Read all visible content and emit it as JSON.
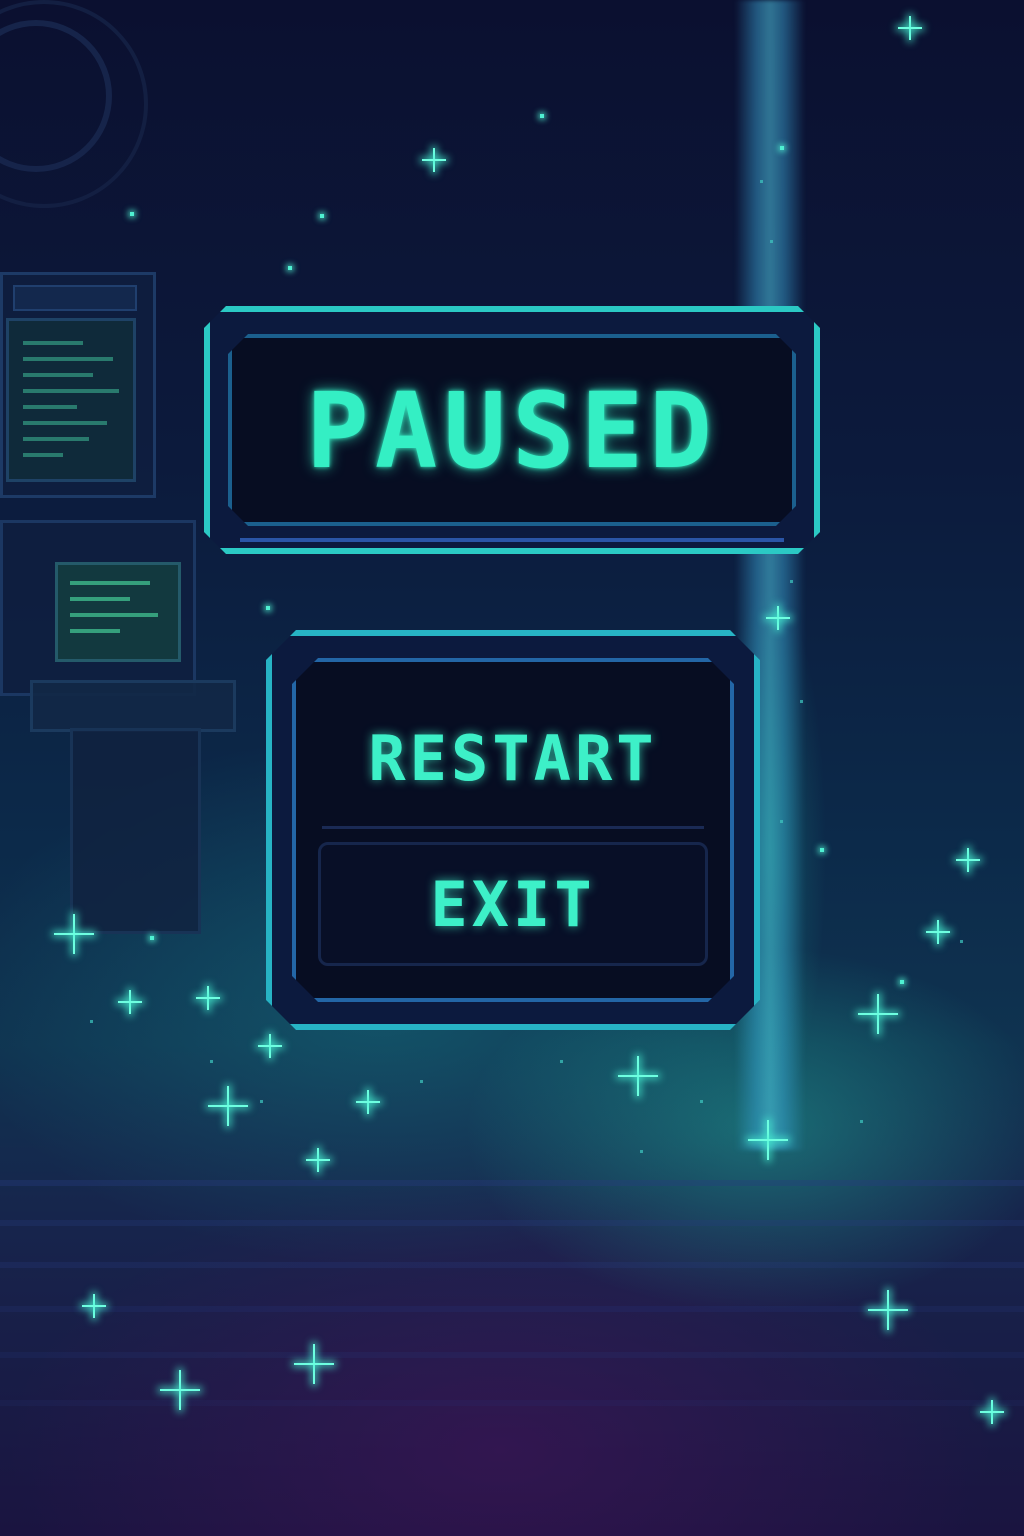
{
  "screen": "pause-menu",
  "title": "PAUSED",
  "menu": {
    "items": [
      {
        "label": "RESTART",
        "state": "default"
      },
      {
        "label": "EXIT",
        "state": "default"
      }
    ]
  },
  "colors": {
    "accent": "#34efc4",
    "panel_border": "#2bc9c4",
    "panel_fill": "#070d22",
    "background_top": "#0b1030",
    "background_bottom": "#1a1440"
  }
}
